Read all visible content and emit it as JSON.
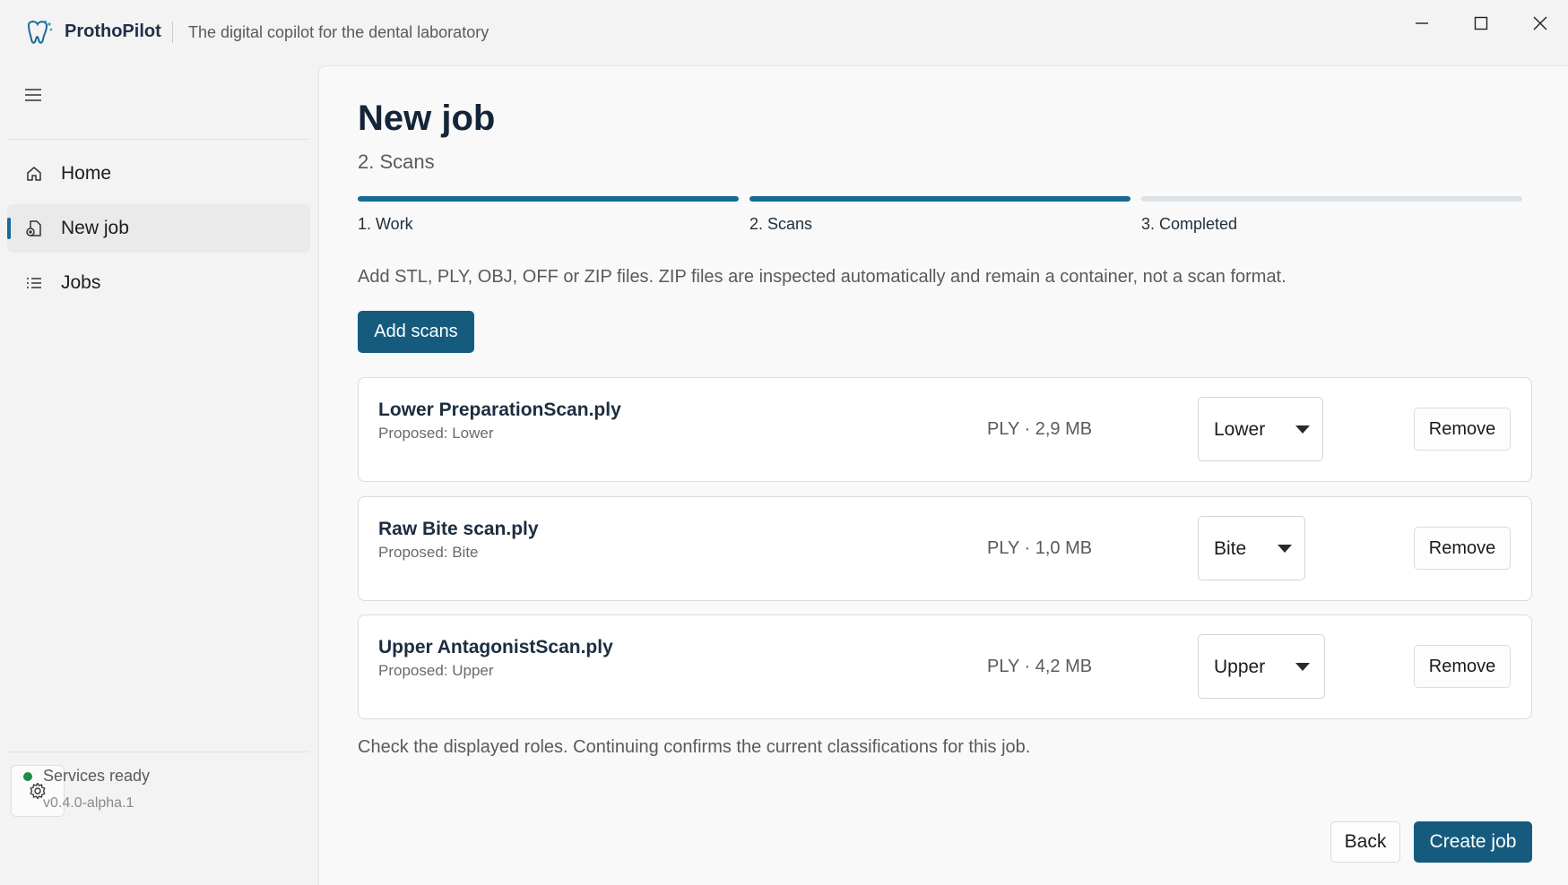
{
  "app": {
    "name": "ProthoPilot",
    "tagline": "The digital copilot for the dental laboratory"
  },
  "sidebar": {
    "items": [
      {
        "label": "Home",
        "icon": "home-icon",
        "active": false
      },
      {
        "label": "New job",
        "icon": "document-plus-icon",
        "active": true
      },
      {
        "label": "Jobs",
        "icon": "list-icon",
        "active": false
      }
    ],
    "status": "Services ready",
    "version": "v0.4.0-alpha.1"
  },
  "main": {
    "title": "New job",
    "subtitle": "2. Scans",
    "steps": [
      {
        "label": "1. Work",
        "done": true
      },
      {
        "label": "2. Scans",
        "done": true
      },
      {
        "label": "3. Completed",
        "done": false
      }
    ],
    "instructions": "Add STL, PLY, OBJ, OFF or ZIP files. ZIP files are inspected automatically and remain a container, not a scan format.",
    "add_scans_label": "Add scans",
    "scans": [
      {
        "name": "Lower PreparationScan.ply",
        "proposed": "Proposed: Lower",
        "meta": "PLY · 2,9 MB",
        "role": "Lower",
        "remove_label": "Remove"
      },
      {
        "name": "Raw Bite scan.ply",
        "proposed": "Proposed: Bite",
        "meta": "PLY · 1,0 MB",
        "role": "Bite",
        "remove_label": "Remove"
      },
      {
        "name": "Upper AntagonistScan.ply",
        "proposed": "Proposed: Upper",
        "meta": "PLY · 4,2 MB",
        "role": "Upper",
        "remove_label": "Remove"
      }
    ],
    "confirm_text": "Check the displayed roles. Continuing confirms the current classifications for this job.",
    "back_label": "Back",
    "create_label": "Create job"
  },
  "colors": {
    "accent": "#145b7e",
    "progress_done": "#1a6a97",
    "progress_todo": "#dde2e6",
    "status_ok": "#1f8a4c"
  }
}
